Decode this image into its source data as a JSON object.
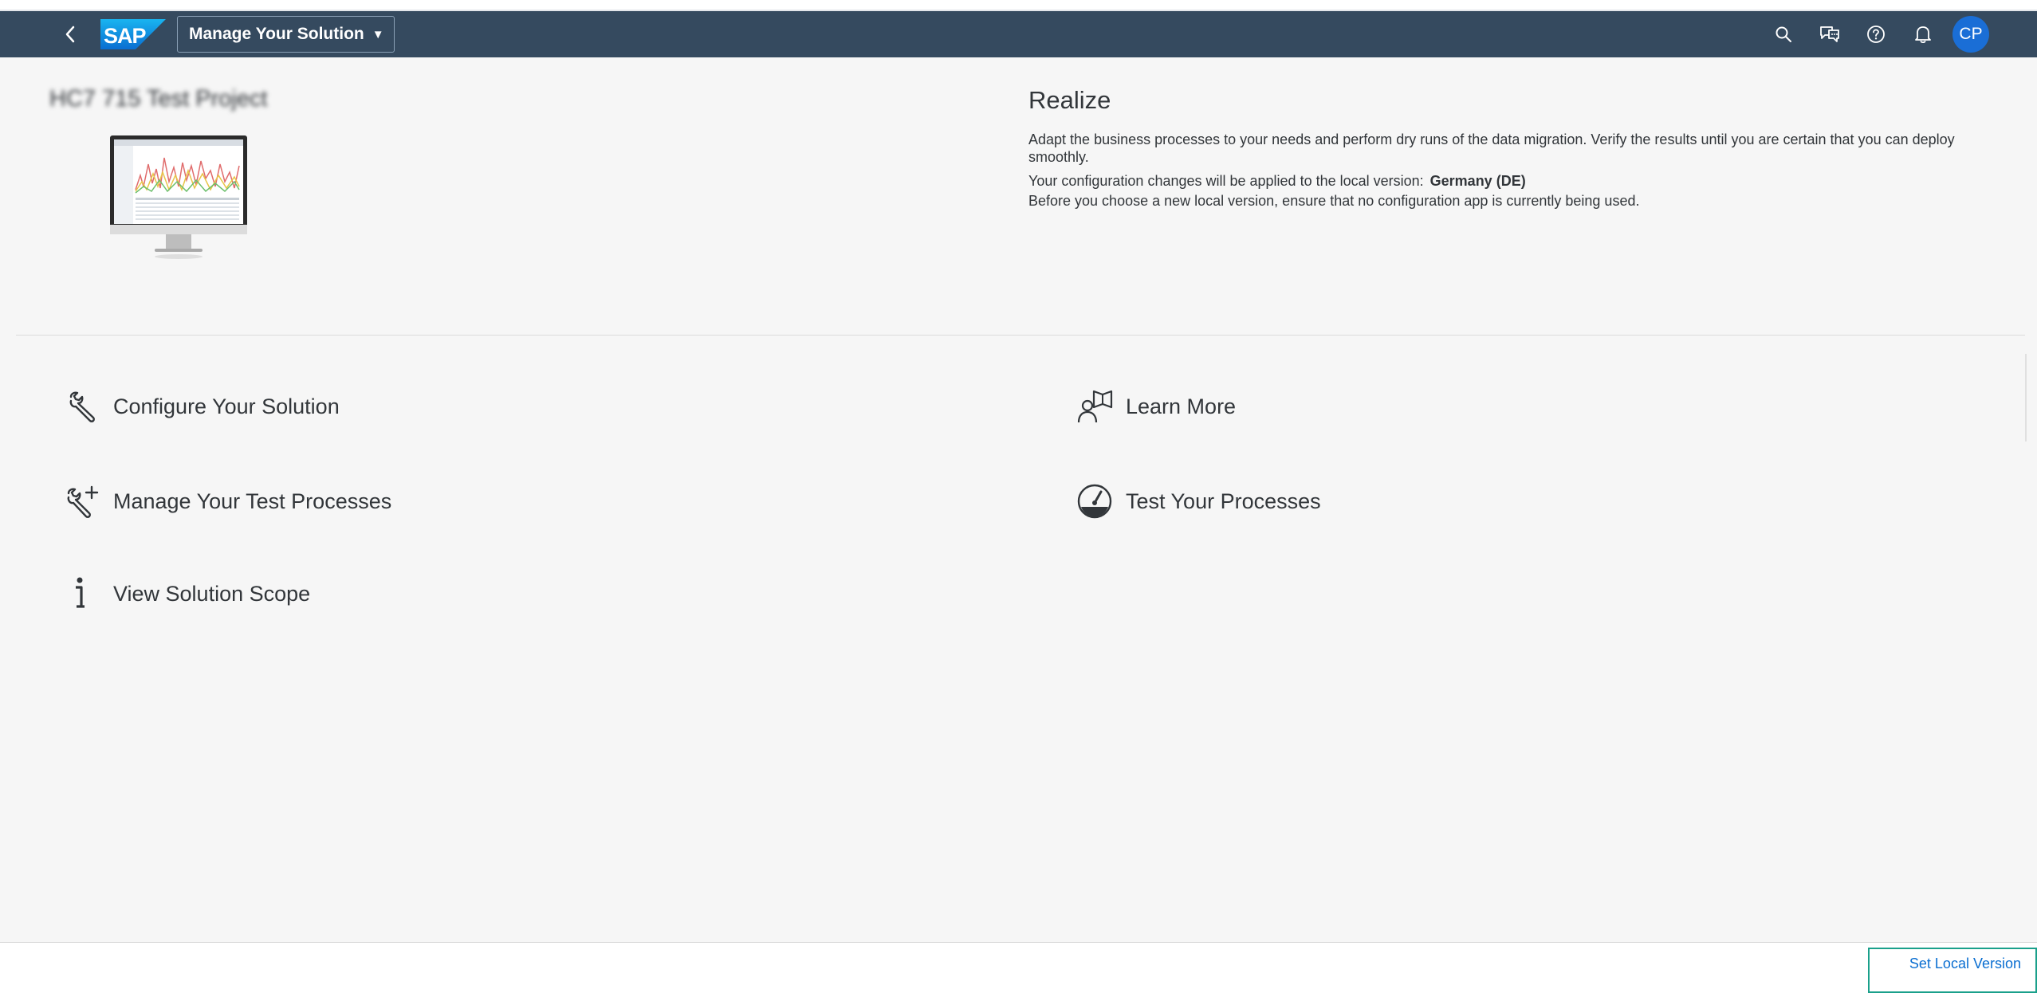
{
  "shellbar": {
    "app_title": "Manage Your Solution",
    "avatar_initials": "CP",
    "colors": {
      "background": "#354a5f",
      "avatar": "#1a6ed6"
    }
  },
  "header": {
    "project_name": "HC7 715 Test Project",
    "phase_title": "Realize",
    "phase_description": "Adapt the business processes to your needs and perform dry runs of the data migration. Verify the results until you are certain that you can deploy smoothly.",
    "local_version_label": "Your configuration changes will be applied to the local version:",
    "local_version_value": "Germany (DE)",
    "local_version_note": "Before you choose a new local version, ensure that no configuration app is currently being used."
  },
  "tiles": {
    "configure": "Configure Your Solution",
    "manage_tests": "Manage Your Test Processes",
    "view_scope": "View Solution Scope",
    "learn_more": "Learn More",
    "test_processes": "Test Your Processes"
  },
  "footer": {
    "set_local_version": "Set Local Version",
    "colors": {
      "link": "#0a6ed1",
      "highlight_border": "#1aa08b"
    }
  }
}
